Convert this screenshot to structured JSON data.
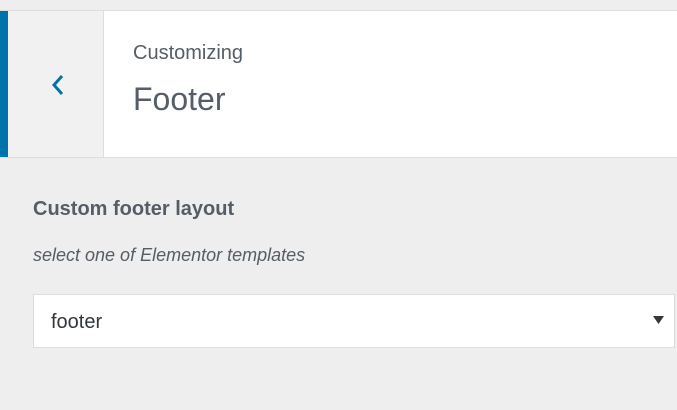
{
  "header": {
    "back_icon": "chevron-left-icon",
    "customizing_label": "Customizing",
    "section_title": "Footer"
  },
  "control": {
    "title": "Custom footer layout",
    "description": "select one of Elementor templates",
    "select": {
      "selected_value": "footer",
      "arrow_icon": "caret-down-icon"
    }
  },
  "colors": {
    "accent": "#0073aa",
    "panel_bg": "#eeeeee",
    "text": "#555d66"
  }
}
